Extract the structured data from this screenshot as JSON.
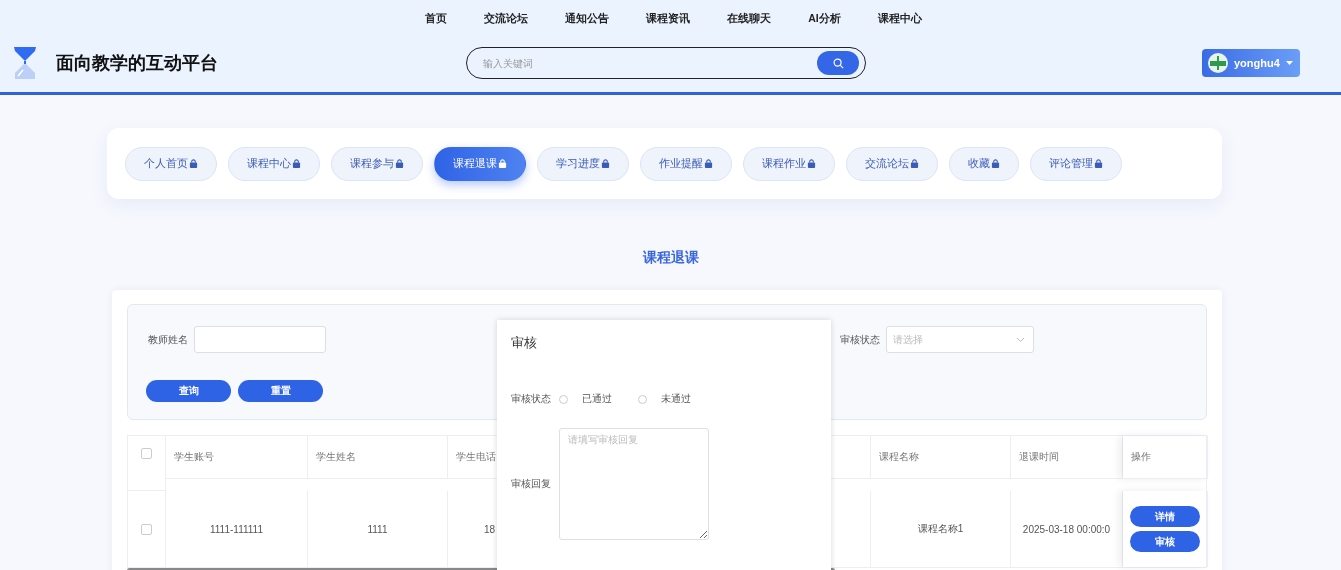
{
  "header": {
    "nav": [
      "首页",
      "交流论坛",
      "通知公告",
      "课程资讯",
      "在线聊天",
      "AI分析",
      "课程中心"
    ],
    "site_title": "面向教学的互动平台",
    "search": {
      "placeholder": "输入关键词"
    },
    "user": {
      "name": "yonghu4"
    }
  },
  "tabs": [
    {
      "label": "个人首页",
      "selected": false
    },
    {
      "label": "课程中心",
      "selected": false
    },
    {
      "label": "课程参与",
      "selected": false
    },
    {
      "label": "课程退课",
      "selected": true
    },
    {
      "label": "学习进度",
      "selected": false
    },
    {
      "label": "作业提醒",
      "selected": false
    },
    {
      "label": "课程作业",
      "selected": false
    },
    {
      "label": "交流论坛",
      "selected": false
    },
    {
      "label": "收藏",
      "selected": false
    },
    {
      "label": "评论管理",
      "selected": false
    }
  ],
  "page_title": "课程退课",
  "filters": [
    {
      "kind": "text",
      "label": "教师姓名"
    },
    {
      "kind": "select",
      "label": "审核状态",
      "placeholder": "请选择"
    }
  ],
  "filter_buttons": [
    "查询",
    "重置"
  ],
  "table": {
    "select_all_checked": false,
    "columns": [
      "学生账号",
      "学生姓名",
      "学生电话",
      "课程名称",
      "退课时间",
      "操作"
    ],
    "rows": [
      {
        "checked": false,
        "cells": [
          "1111-111111",
          "1111",
          "18",
          "课程名称1",
          "2025-03-18 00:00:0"
        ],
        "actions": [
          "详情",
          "审核"
        ]
      }
    ]
  },
  "dialog": {
    "title": "审核",
    "status_label": "审核状态",
    "options": [
      {
        "label": "已通过",
        "selected": false
      },
      {
        "label": "未通过",
        "selected": false
      }
    ],
    "reply_label": "审核回复",
    "reply_placeholder": "请填写审核回复"
  }
}
